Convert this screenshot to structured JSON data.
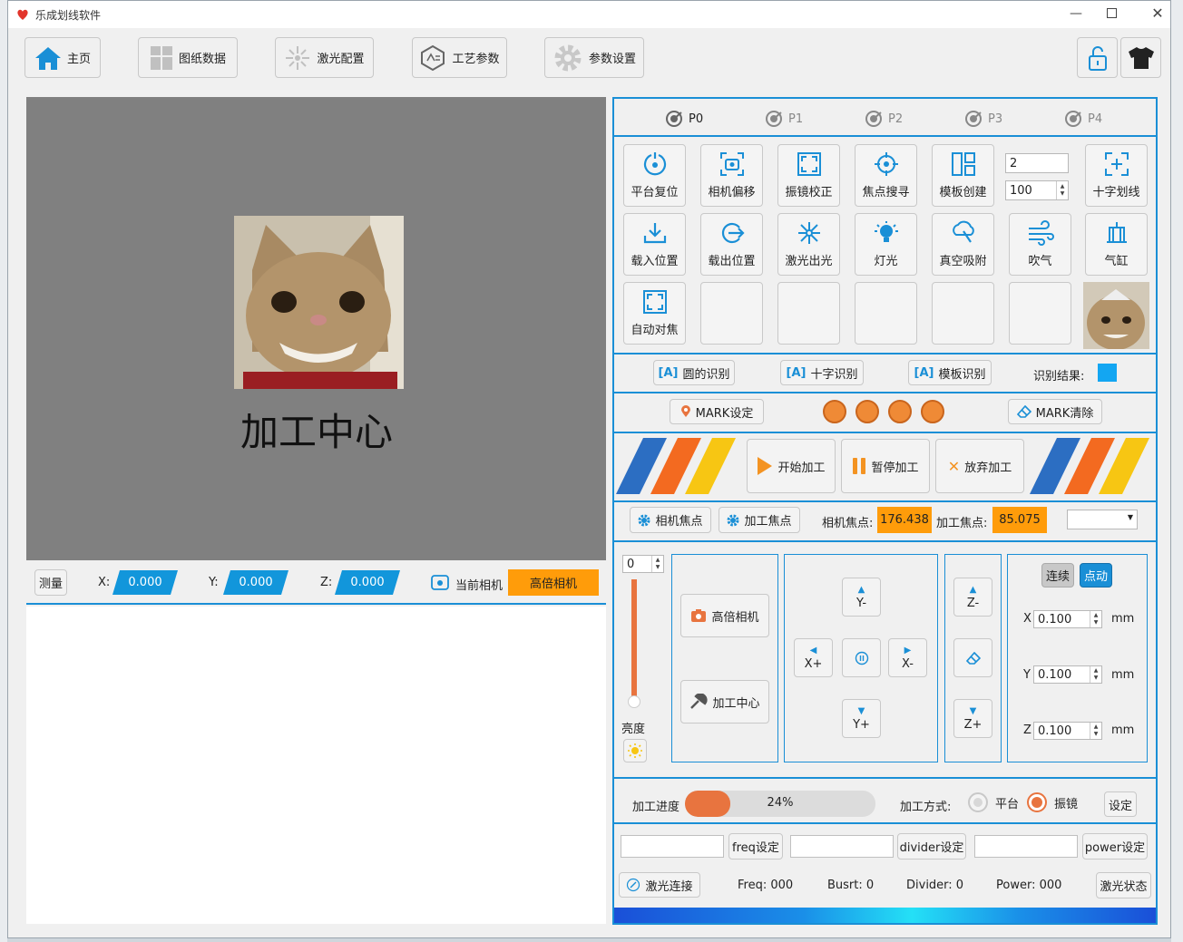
{
  "window": {
    "title": "乐成划线软件"
  },
  "toolbar": {
    "home": "主页",
    "drawing": "图纸数据",
    "laser_cfg": "激光配置",
    "process": "工艺参数",
    "params": "参数设置"
  },
  "preview": {
    "title": "加工中心"
  },
  "coords": {
    "measure": "测量",
    "x_label": "X:",
    "x": "0.000",
    "y_label": "Y:",
    "y": "0.000",
    "z_label": "Z:",
    "z": "0.000",
    "cur_cam_label": "当前相机",
    "cur_cam": "高倍相机"
  },
  "ptabs": [
    "P0",
    "P1",
    "P2",
    "P3",
    "P4"
  ],
  "grid": {
    "row1": [
      "平台复位",
      "相机偏移",
      "振镜校正",
      "焦点搜寻",
      "模板创建"
    ],
    "spin_a": "2",
    "spin_b": "100",
    "cross": "十字划线",
    "row2": [
      "载入位置",
      "载出位置",
      "激光出光",
      "灯光",
      "真空吸附",
      "吹气",
      "气缸"
    ],
    "autofocus": "自动对焦"
  },
  "recog": {
    "circle": "圆的识别",
    "cross": "十字识别",
    "template": "模板识别",
    "result_label": "识别结果:"
  },
  "mark": {
    "set": "MARK设定",
    "clear": "MARK清除"
  },
  "process": {
    "start": "开始加工",
    "pause": "暂停加工",
    "abort": "放弃加工"
  },
  "focus": {
    "cam_btn": "相机焦点",
    "proc_btn": "加工焦点",
    "cam_label": "相机焦点:",
    "cam_val": "176.438",
    "proc_label": "加工焦点:",
    "proc_val": "85.075"
  },
  "light": {
    "value": "0",
    "label": "亮度",
    "level": 0
  },
  "camera": {
    "high": "高倍相机",
    "center": "加工中心"
  },
  "jog": {
    "y_minus": "Y-",
    "x_plus": "X+",
    "x_minus": "X-",
    "y_plus": "Y+",
    "z_minus": "Z-",
    "z_plus": "Z+"
  },
  "step": {
    "continuous": "连续",
    "jog": "点动",
    "x_label": "X",
    "x": "0.100",
    "y_label": "Y",
    "y": "0.100",
    "z_label": "Z",
    "z": "0.100",
    "unit": "mm"
  },
  "progress": {
    "label": "加工进度",
    "value": 24,
    "text": "24%",
    "mode_label": "加工方式:",
    "platform": "平台",
    "galvo": "振镜",
    "set": "设定"
  },
  "laser": {
    "freq_btn": "freq设定",
    "divider_btn": "divider设定",
    "power_btn": "power设定",
    "connect": "激光连接",
    "freq": "Freq: 000",
    "burst": "Busrt: 0",
    "divider": "Divider: 0",
    "power": "Power: 000",
    "status": "激光状态"
  },
  "colors": {
    "accent": "#1a8fd6",
    "orange": "#ff9c0a",
    "progress": "#e8743f"
  }
}
